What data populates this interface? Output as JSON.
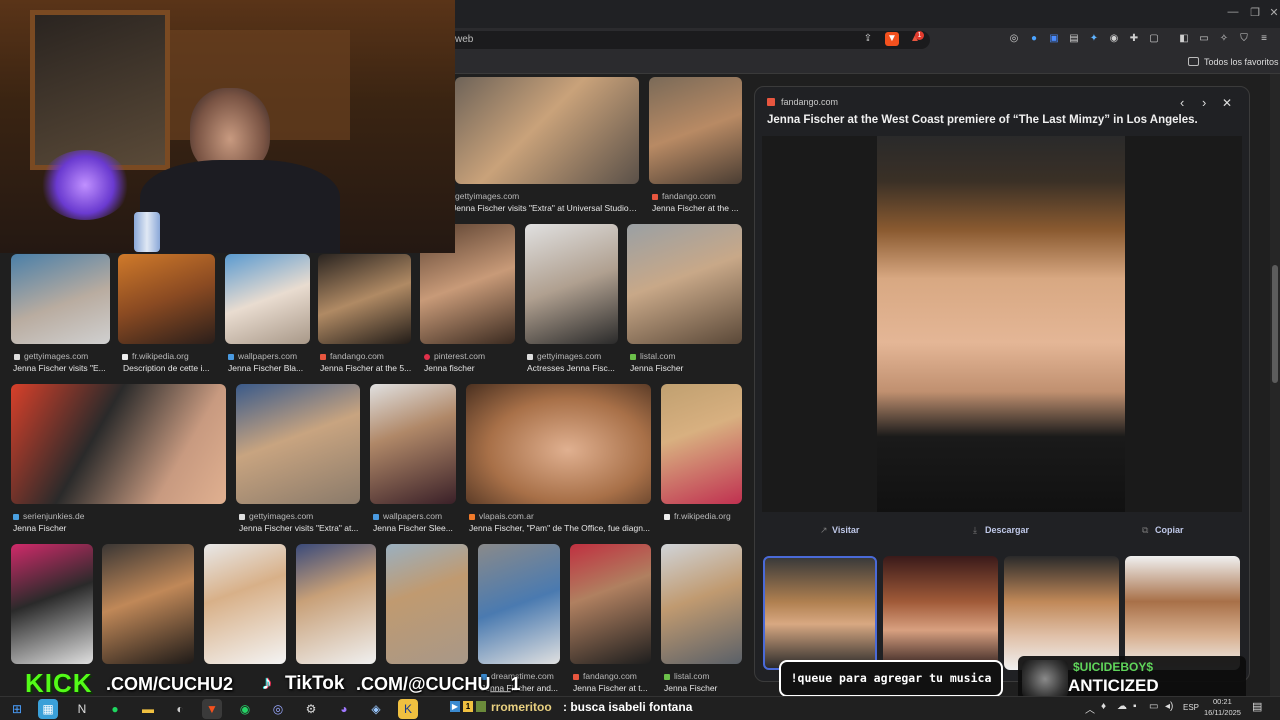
{
  "browser": {
    "url_fragment": "web",
    "bookmarks_label": "Todos los favoritos",
    "brave_badge": "1"
  },
  "results": [
    {
      "source": "gettyimages.com",
      "caption": "Jenna Fischer visits \"Extra\" at Universal Studios Hol...",
      "color": "#b8b0a6"
    },
    {
      "source": "fandango.com",
      "caption": "Jenna Fischer at the ...",
      "color": "#8a7060"
    },
    {
      "source": "gettyimages.com",
      "caption": "Jenna Fischer visits \"E...",
      "color": "#a9a7a5"
    },
    {
      "source": "fr.wikipedia.org",
      "caption": "Description de cette i...",
      "color": "#7a4a2a"
    },
    {
      "source": "wallpapers.com",
      "caption": "Jenna Fischer Bla...",
      "color": "#c7bfb7"
    },
    {
      "source": "fandango.com",
      "caption": "Jenna Fischer at the 5...",
      "color": "#3a2e26"
    },
    {
      "source": "pinterest.com",
      "caption": "Jenna fischer",
      "color": "#4a3628"
    },
    {
      "source": "gettyimages.com",
      "caption": "Actresses Jenna Fisc...",
      "color": "#b5b5b5"
    },
    {
      "source": "listal.com",
      "caption": "Jenna Fischer",
      "color": "#9c8a78"
    },
    {
      "source": "serienjunkies.de",
      "caption": "Jenna Fischer",
      "color": "#b85a38"
    },
    {
      "source": "gettyimages.com",
      "caption": "Jenna Fischer visits \"Extra\" at...",
      "color": "#b0a598"
    },
    {
      "source": "wallpapers.com",
      "caption": "Jenna Fischer Slee...",
      "color": "#cfcfcf"
    },
    {
      "source": "vlapais.com.ar",
      "caption": "Jenna Fischer, \"Pam\" de The Office, fue diagn...",
      "color": "#9a7050"
    },
    {
      "source": "fr.wikipedia.org",
      "caption": "",
      "color": "#8a5a3a"
    },
    {
      "source": "",
      "caption": "",
      "color": "#a0a0a0"
    },
    {
      "source": "",
      "caption": "",
      "color": "#2e2a28"
    },
    {
      "source": "",
      "caption": "",
      "color": "#d8d8d4"
    },
    {
      "source": "",
      "caption": "",
      "color": "#3a3a40"
    },
    {
      "source": "",
      "caption": "",
      "color": "#9c8f7c"
    },
    {
      "source": "dreamstime.com",
      "caption": "Jenna Fischer and...",
      "color": "#b7a99a"
    },
    {
      "source": "fandango.com",
      "caption": "Jenna Fischer at t...",
      "color": "#4a3a30"
    },
    {
      "source": "listal.com",
      "caption": "Jenna Fischer",
      "color": "#8c9aa5"
    }
  ],
  "preview": {
    "source": "fandango.com",
    "title": "Jenna Fischer at the West Coast premiere of “The Last Mimzy” in Los Angeles.",
    "visit_label": "Visitar",
    "download_label": "Descargar",
    "copy_label": "Copiar"
  },
  "overlay": {
    "kick_label": "KICK",
    "kick_handle": ".COM/CUCHU2",
    "tiktok_label": "TikTok",
    "tiktok_handle": ".COM/@CUCHU__1",
    "queue_text": "!queue para agregar tu musica",
    "music_artist": "$UICIDEBOY$",
    "music_title": "ANTICIZED",
    "chat_user": "rromeritoo",
    "chat_message": ": busca isabeli fontana"
  },
  "taskbar": {
    "language": "ESP",
    "time": "00:21",
    "date": "16/11/2025"
  }
}
